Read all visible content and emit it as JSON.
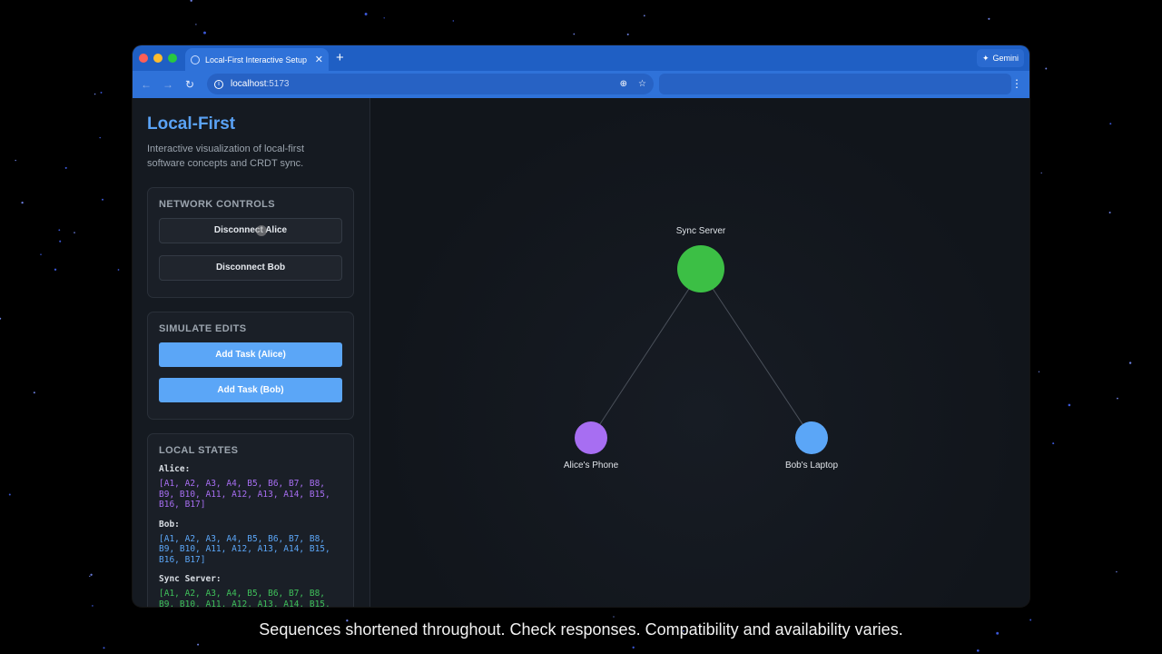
{
  "browser": {
    "tab_title": "Local-First Interactive Setup",
    "new_tab": "+",
    "gemini_label": "Gemini",
    "url_host": "localhost",
    "url_port": ":5173"
  },
  "app": {
    "title": "Local-First",
    "description": "Interactive visualization of local-first software concepts and CRDT sync."
  },
  "network_controls": {
    "heading": "NETWORK CONTROLS",
    "disconnect_alice": "Disconnect Alice",
    "disconnect_bob": "Disconnect Bob"
  },
  "simulate_edits": {
    "heading": "SIMULATE EDITS",
    "add_alice": "Add Task (Alice)",
    "add_bob": "Add Task (Bob)"
  },
  "local_states": {
    "heading": "LOCAL STATES",
    "alice_label": "Alice:",
    "alice_value": "[A1, A2, A3, A4, B5, B6, B7, B8, B9, B10, A11, A12, A13, A14, B15, B16, B17]",
    "bob_label": "Bob:",
    "bob_value": "[A1, A2, A3, A4, B5, B6, B7, B8, B9, B10, A11, A12, A13, A14, B15, B16, B17]",
    "server_label": "Sync Server:",
    "server_value": "[A1, A2, A3, A4, B5, B6, B7, B8, B9, B10, A11, A12, A13, A14, B15,"
  },
  "graph": {
    "server_label": "Sync Server",
    "alice_label": "Alice's Phone",
    "bob_label": "Bob's Laptop",
    "colors": {
      "server": "#3cbf45",
      "alice": "#a76ef2",
      "bob": "#5ba6f7"
    }
  },
  "caption": "Sequences shortened throughout. Check responses. Compatibility and availability varies."
}
